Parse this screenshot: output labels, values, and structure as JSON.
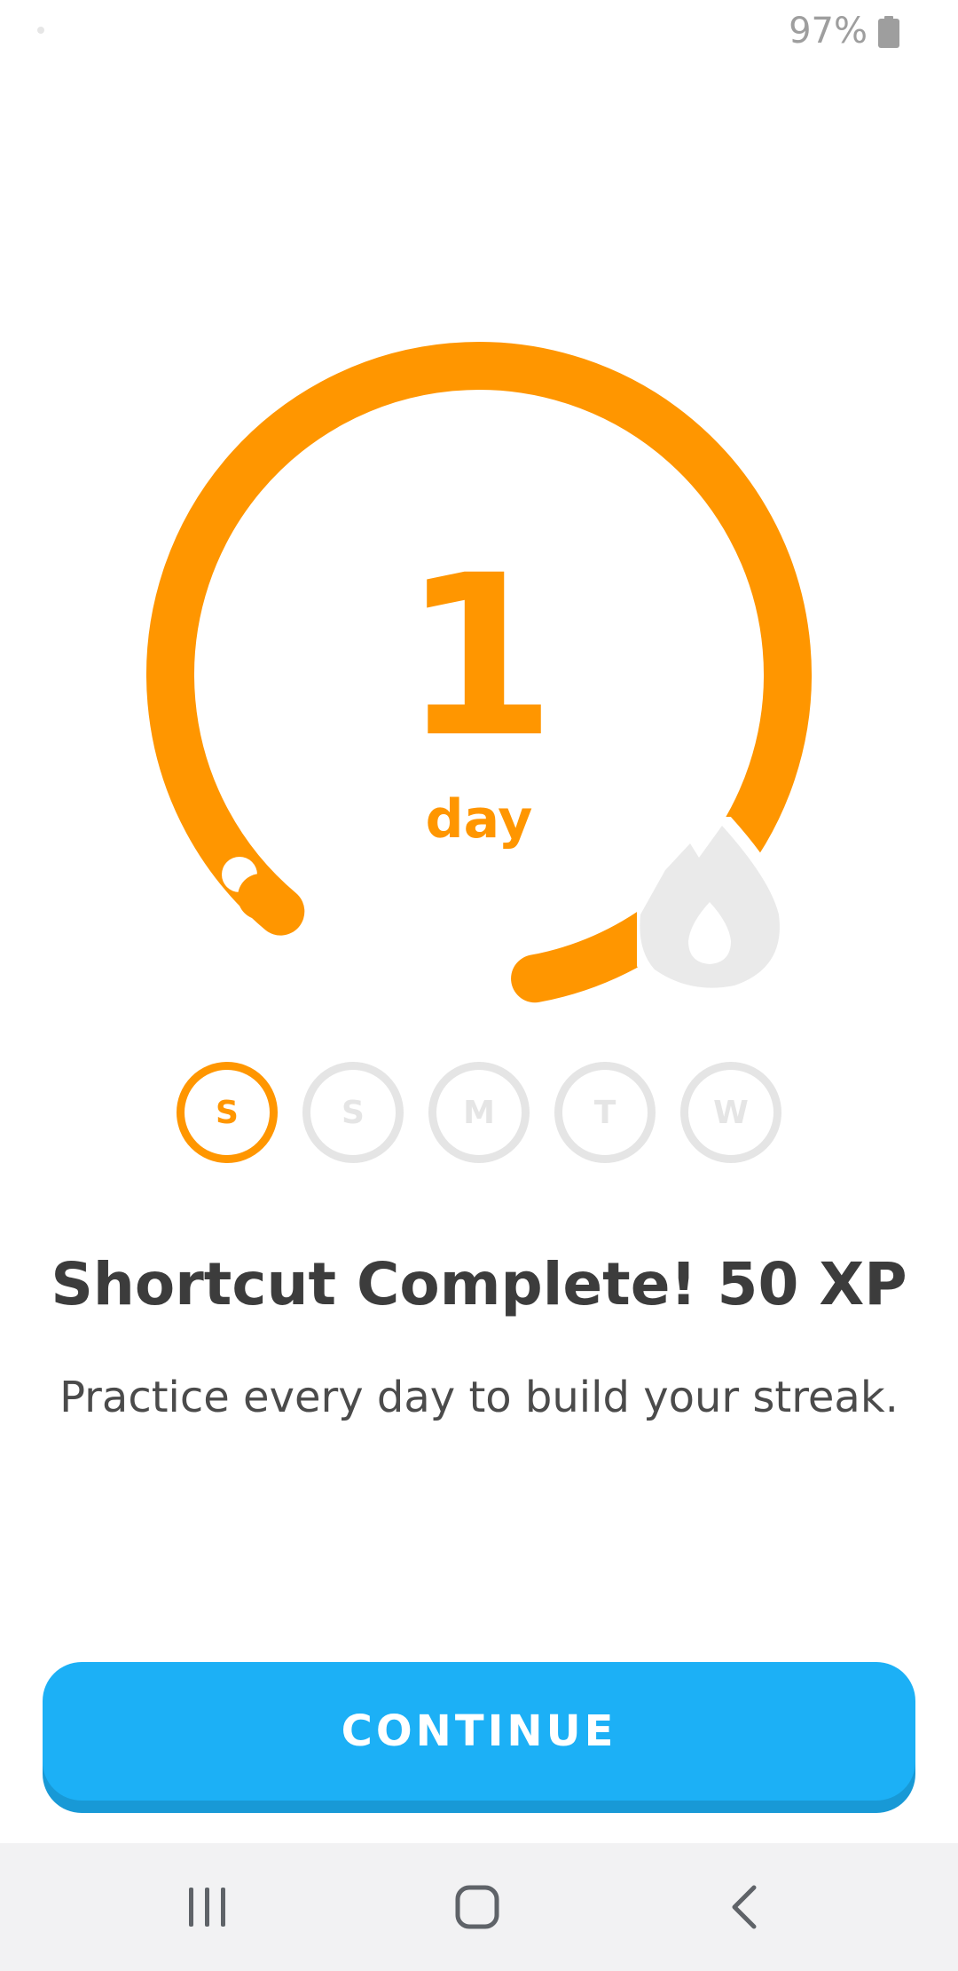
{
  "status_bar": {
    "battery_percent": "97%",
    "battery_icon": "battery-icon"
  },
  "streak": {
    "count": "1",
    "unit": "day",
    "progress": 0.86,
    "flame_icon": "flame-icon",
    "accent_color": "#ff9600",
    "inactive_color": "#e5e5e5"
  },
  "days": [
    {
      "label": "S",
      "active": true
    },
    {
      "label": "S",
      "active": false
    },
    {
      "label": "M",
      "active": false
    },
    {
      "label": "T",
      "active": false
    },
    {
      "label": "W",
      "active": false
    }
  ],
  "main": {
    "title": "Shortcut Complete! 50 XP",
    "subtitle": "Practice every day to build your streak."
  },
  "continue_button": {
    "label": "CONTINUE",
    "color": "#1cb0f6"
  },
  "nav_bar": {
    "recents_icon": "recents-icon",
    "home_icon": "home-icon",
    "back_icon": "back-icon"
  }
}
